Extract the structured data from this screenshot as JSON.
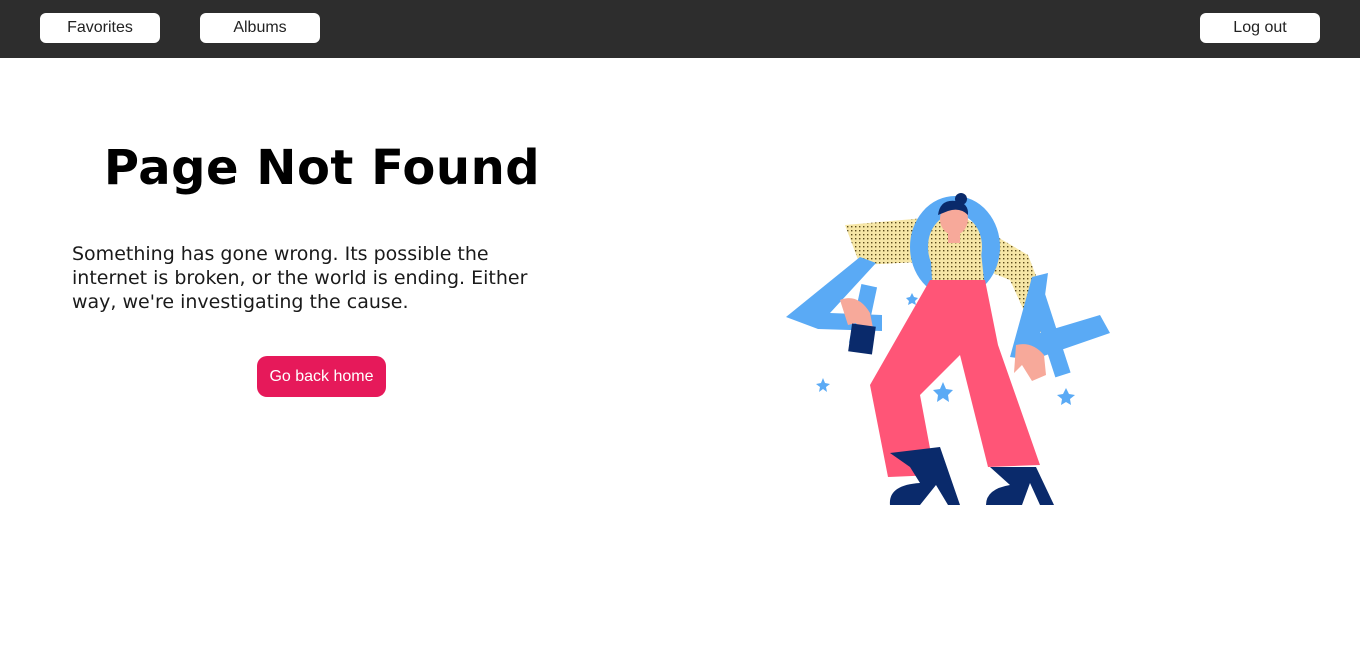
{
  "nav": {
    "favorites_label": "Favorites",
    "albums_label": "Albums",
    "logout_label": "Log out"
  },
  "main": {
    "title": "Page Not Found",
    "message": "Something has gone wrong. Its possible the internet is broken, or the world is ending. Either way, we're investigating the cause.",
    "home_button_label": "Go back home"
  },
  "illustration": {
    "icon": "404-person-illustration"
  },
  "colors": {
    "topbar": "#2d2d2d",
    "accent": "#e6195a",
    "figure_blue": "#5aaaf5",
    "pants_pink": "#ff5577",
    "navy": "#0a2a6b",
    "sweater_yellow": "#f6e6a6",
    "skin": "#f7a99a"
  }
}
